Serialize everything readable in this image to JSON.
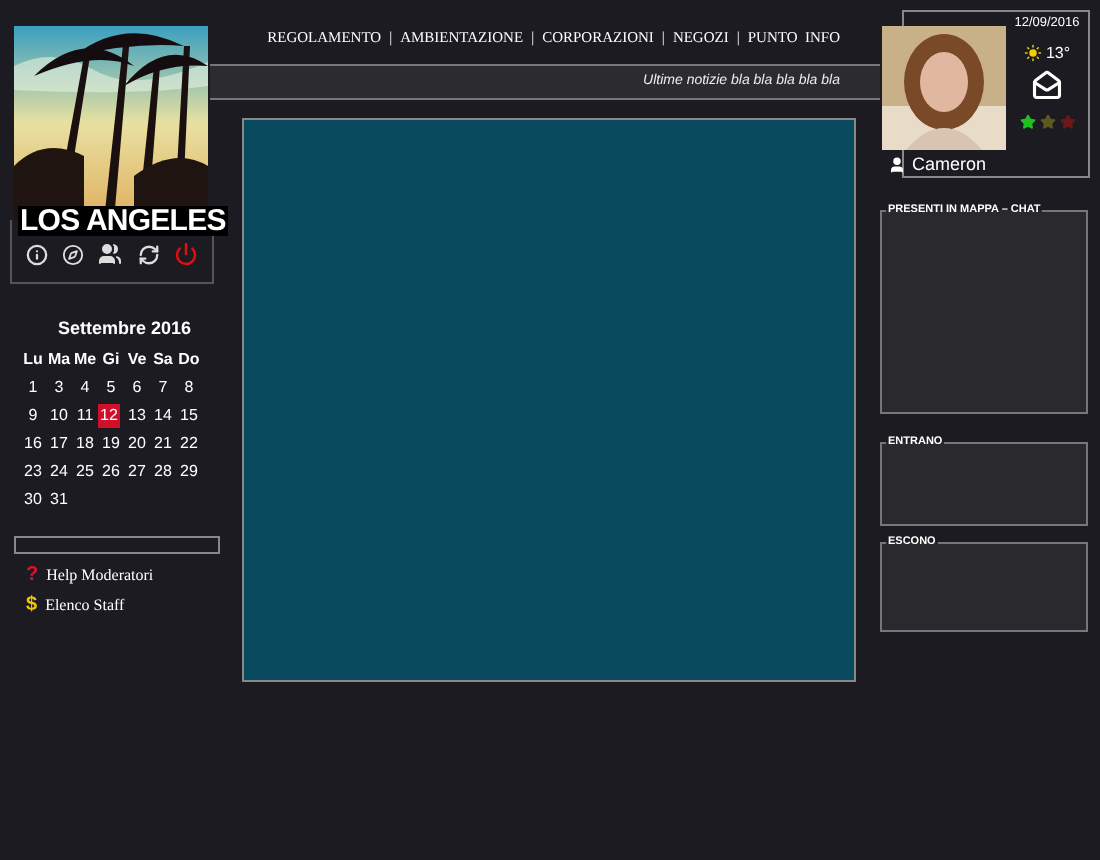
{
  "location": {
    "name": "LOS ANGELES"
  },
  "nav": {
    "separator": "|",
    "items": [
      "REGOLAMENTO",
      "AMBIENTAZIONE",
      "CORPORAZIONI",
      "NEGOZI",
      "PUNTO  INFO"
    ]
  },
  "news": "Ultime notizie bla bla bla bla bla",
  "calendar": {
    "title": "Settembre 2016",
    "weekdays": [
      "Lu",
      "Ma",
      "Me",
      "Gi",
      "Ve",
      "Sa",
      "Do"
    ],
    "weeks": [
      [
        {
          "day": "1",
          "selected": false
        },
        {
          "day": "3",
          "selected": false
        },
        {
          "day": "4",
          "selected": false
        },
        {
          "day": "5",
          "selected": false
        },
        {
          "day": "6",
          "selected": false
        },
        {
          "day": "7",
          "selected": false
        },
        {
          "day": "8",
          "selected": false
        }
      ],
      [
        {
          "day": "9",
          "selected": false
        },
        {
          "day": "10",
          "selected": false
        },
        {
          "day": "11",
          "selected": false
        },
        {
          "day": "12",
          "selected": true
        },
        {
          "day": "13",
          "selected": false
        },
        {
          "day": "14",
          "selected": false
        },
        {
          "day": "15",
          "selected": false
        }
      ],
      [
        {
          "day": "16",
          "selected": false
        },
        {
          "day": "17",
          "selected": false
        },
        {
          "day": "18",
          "selected": false
        },
        {
          "day": "19",
          "selected": false
        },
        {
          "day": "20",
          "selected": false
        },
        {
          "day": "21",
          "selected": false
        },
        {
          "day": "22",
          "selected": false
        }
      ],
      [
        {
          "day": "23",
          "selected": false
        },
        {
          "day": "24",
          "selected": false
        },
        {
          "day": "25",
          "selected": false
        },
        {
          "day": "26",
          "selected": false
        },
        {
          "day": "27",
          "selected": false
        },
        {
          "day": "28",
          "selected": false
        },
        {
          "day": "29",
          "selected": false
        }
      ],
      [
        {
          "day": "30",
          "selected": false
        },
        {
          "day": "31",
          "selected": false
        }
      ]
    ]
  },
  "links": [
    {
      "icon": "?",
      "label": "Help Moderatori",
      "color": "#e0102a"
    },
    {
      "icon": "$",
      "label": "Elenco Staff",
      "color": "#f0c800"
    }
  ],
  "profile": {
    "date": "12/09/2016",
    "temperature": "13°",
    "name": "Cameron",
    "stars": [
      {
        "color": "#20c020"
      },
      {
        "color": "#5c5a22"
      },
      {
        "color": "#6a1818"
      }
    ]
  },
  "panels": [
    {
      "title": "PRESENTI IN MAPPA – CHAT"
    },
    {
      "title": "ENTRANO"
    },
    {
      "title": "ESCONO"
    }
  ]
}
